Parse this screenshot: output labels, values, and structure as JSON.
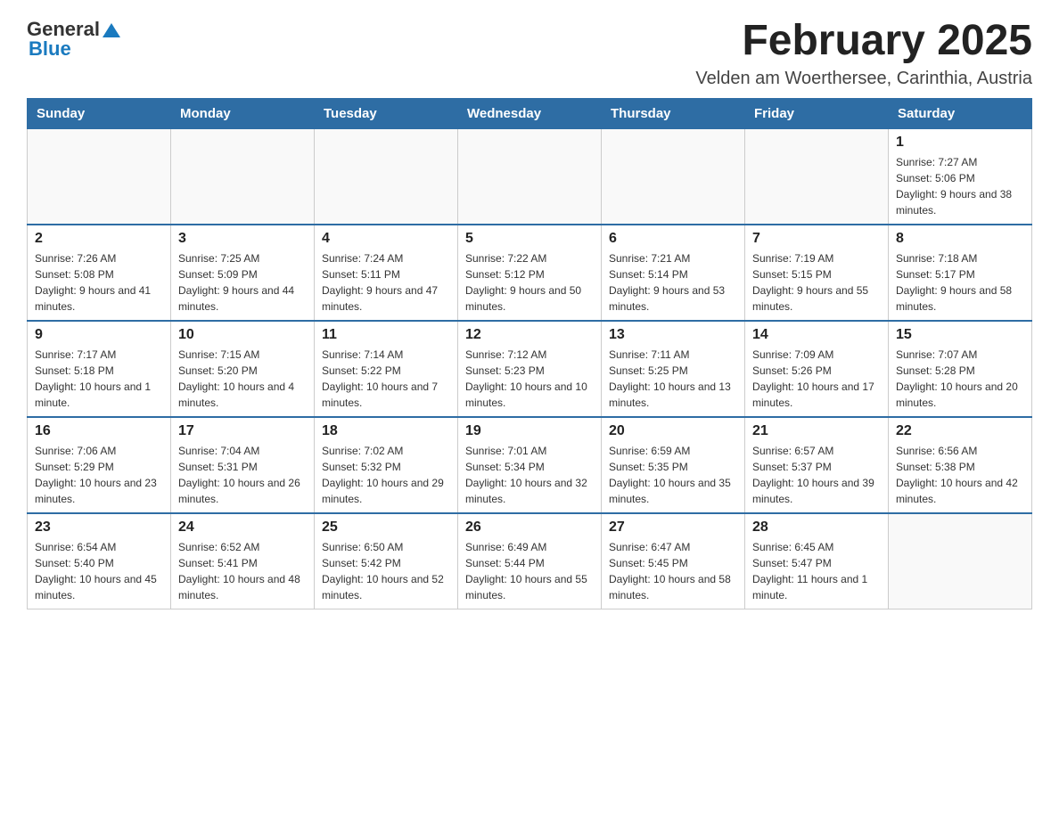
{
  "header": {
    "logo_general": "General",
    "logo_blue": "Blue",
    "month_title": "February 2025",
    "location": "Velden am Woerthersee, Carinthia, Austria"
  },
  "weekdays": [
    "Sunday",
    "Monday",
    "Tuesday",
    "Wednesday",
    "Thursday",
    "Friday",
    "Saturday"
  ],
  "weeks": [
    [
      {
        "day": "",
        "info": ""
      },
      {
        "day": "",
        "info": ""
      },
      {
        "day": "",
        "info": ""
      },
      {
        "day": "",
        "info": ""
      },
      {
        "day": "",
        "info": ""
      },
      {
        "day": "",
        "info": ""
      },
      {
        "day": "1",
        "info": "Sunrise: 7:27 AM\nSunset: 5:06 PM\nDaylight: 9 hours and 38 minutes."
      }
    ],
    [
      {
        "day": "2",
        "info": "Sunrise: 7:26 AM\nSunset: 5:08 PM\nDaylight: 9 hours and 41 minutes."
      },
      {
        "day": "3",
        "info": "Sunrise: 7:25 AM\nSunset: 5:09 PM\nDaylight: 9 hours and 44 minutes."
      },
      {
        "day": "4",
        "info": "Sunrise: 7:24 AM\nSunset: 5:11 PM\nDaylight: 9 hours and 47 minutes."
      },
      {
        "day": "5",
        "info": "Sunrise: 7:22 AM\nSunset: 5:12 PM\nDaylight: 9 hours and 50 minutes."
      },
      {
        "day": "6",
        "info": "Sunrise: 7:21 AM\nSunset: 5:14 PM\nDaylight: 9 hours and 53 minutes."
      },
      {
        "day": "7",
        "info": "Sunrise: 7:19 AM\nSunset: 5:15 PM\nDaylight: 9 hours and 55 minutes."
      },
      {
        "day": "8",
        "info": "Sunrise: 7:18 AM\nSunset: 5:17 PM\nDaylight: 9 hours and 58 minutes."
      }
    ],
    [
      {
        "day": "9",
        "info": "Sunrise: 7:17 AM\nSunset: 5:18 PM\nDaylight: 10 hours and 1 minute."
      },
      {
        "day": "10",
        "info": "Sunrise: 7:15 AM\nSunset: 5:20 PM\nDaylight: 10 hours and 4 minutes."
      },
      {
        "day": "11",
        "info": "Sunrise: 7:14 AM\nSunset: 5:22 PM\nDaylight: 10 hours and 7 minutes."
      },
      {
        "day": "12",
        "info": "Sunrise: 7:12 AM\nSunset: 5:23 PM\nDaylight: 10 hours and 10 minutes."
      },
      {
        "day": "13",
        "info": "Sunrise: 7:11 AM\nSunset: 5:25 PM\nDaylight: 10 hours and 13 minutes."
      },
      {
        "day": "14",
        "info": "Sunrise: 7:09 AM\nSunset: 5:26 PM\nDaylight: 10 hours and 17 minutes."
      },
      {
        "day": "15",
        "info": "Sunrise: 7:07 AM\nSunset: 5:28 PM\nDaylight: 10 hours and 20 minutes."
      }
    ],
    [
      {
        "day": "16",
        "info": "Sunrise: 7:06 AM\nSunset: 5:29 PM\nDaylight: 10 hours and 23 minutes."
      },
      {
        "day": "17",
        "info": "Sunrise: 7:04 AM\nSunset: 5:31 PM\nDaylight: 10 hours and 26 minutes."
      },
      {
        "day": "18",
        "info": "Sunrise: 7:02 AM\nSunset: 5:32 PM\nDaylight: 10 hours and 29 minutes."
      },
      {
        "day": "19",
        "info": "Sunrise: 7:01 AM\nSunset: 5:34 PM\nDaylight: 10 hours and 32 minutes."
      },
      {
        "day": "20",
        "info": "Sunrise: 6:59 AM\nSunset: 5:35 PM\nDaylight: 10 hours and 35 minutes."
      },
      {
        "day": "21",
        "info": "Sunrise: 6:57 AM\nSunset: 5:37 PM\nDaylight: 10 hours and 39 minutes."
      },
      {
        "day": "22",
        "info": "Sunrise: 6:56 AM\nSunset: 5:38 PM\nDaylight: 10 hours and 42 minutes."
      }
    ],
    [
      {
        "day": "23",
        "info": "Sunrise: 6:54 AM\nSunset: 5:40 PM\nDaylight: 10 hours and 45 minutes."
      },
      {
        "day": "24",
        "info": "Sunrise: 6:52 AM\nSunset: 5:41 PM\nDaylight: 10 hours and 48 minutes."
      },
      {
        "day": "25",
        "info": "Sunrise: 6:50 AM\nSunset: 5:42 PM\nDaylight: 10 hours and 52 minutes."
      },
      {
        "day": "26",
        "info": "Sunrise: 6:49 AM\nSunset: 5:44 PM\nDaylight: 10 hours and 55 minutes."
      },
      {
        "day": "27",
        "info": "Sunrise: 6:47 AM\nSunset: 5:45 PM\nDaylight: 10 hours and 58 minutes."
      },
      {
        "day": "28",
        "info": "Sunrise: 6:45 AM\nSunset: 5:47 PM\nDaylight: 11 hours and 1 minute."
      },
      {
        "day": "",
        "info": ""
      }
    ]
  ]
}
